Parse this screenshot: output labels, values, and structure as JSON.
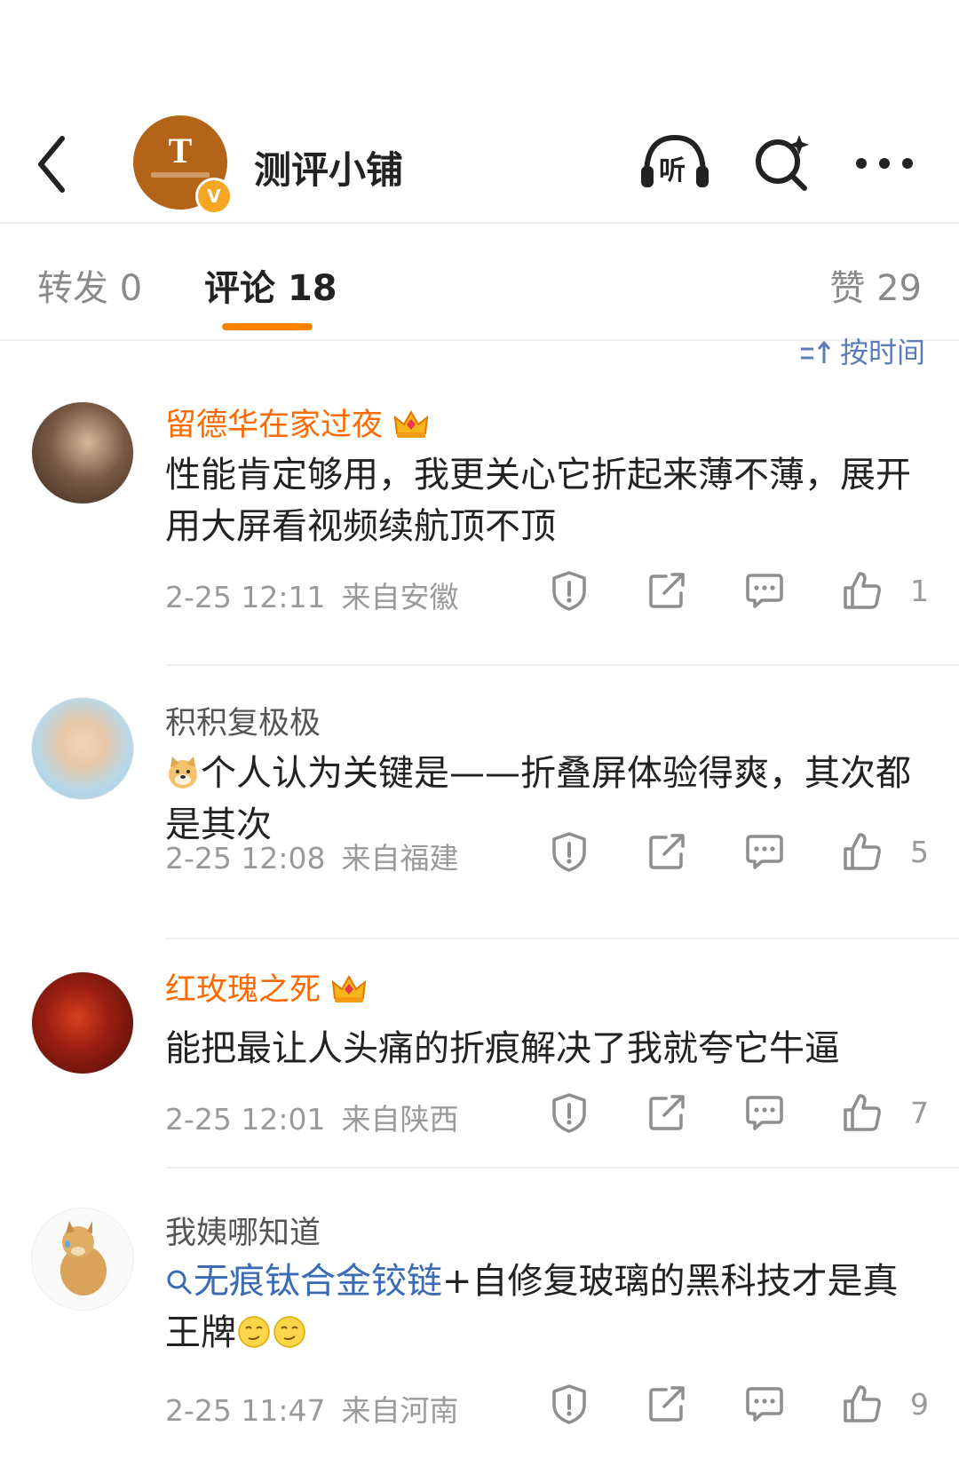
{
  "header": {
    "title": "测评小铺",
    "avatar_letter": "T",
    "verified_badge": "V",
    "listen_label": "听",
    "icons": [
      "back-icon",
      "listen-icon",
      "search-sparkle-icon",
      "more-icon"
    ]
  },
  "tabs": [
    {
      "label": "转发",
      "count": "0"
    },
    {
      "label": "评论",
      "count": "18"
    },
    {
      "label": "赞",
      "count": "29"
    }
  ],
  "sort_label": "按时间",
  "comments": [
    {
      "user": "留德华在家过夜",
      "text": "性能肯定够用，我更关心它折起来薄不薄，展开用大屏看视频续航顶不顶",
      "time": "2-25 12:11",
      "location": "来自安徽",
      "likes": "1"
    },
    {
      "user": "积积复极极",
      "text": "个人认为关键是——折叠屏体验得爽，其次都是其次",
      "time": "2-25 12:08",
      "location": "来自福建",
      "likes": "5"
    },
    {
      "user": "红玫瑰之死",
      "text": "能把最让人头痛的折痕解决了我就夸它牛逼",
      "time": "2-25 12:01",
      "location": "来自陕西",
      "likes": "7"
    },
    {
      "user": "我姨哪知道",
      "topic": "无痕钛合金铰链",
      "text": "+自修复玻璃的黑科技才是真王牌",
      "time": "2-25 11:47",
      "location": "来自河南",
      "likes": "9"
    }
  ],
  "colors": {
    "accent": "#ff8200",
    "name_vip": "#ff6a00",
    "topic": "#3a6bb5",
    "meta": "#9a9a9a"
  }
}
